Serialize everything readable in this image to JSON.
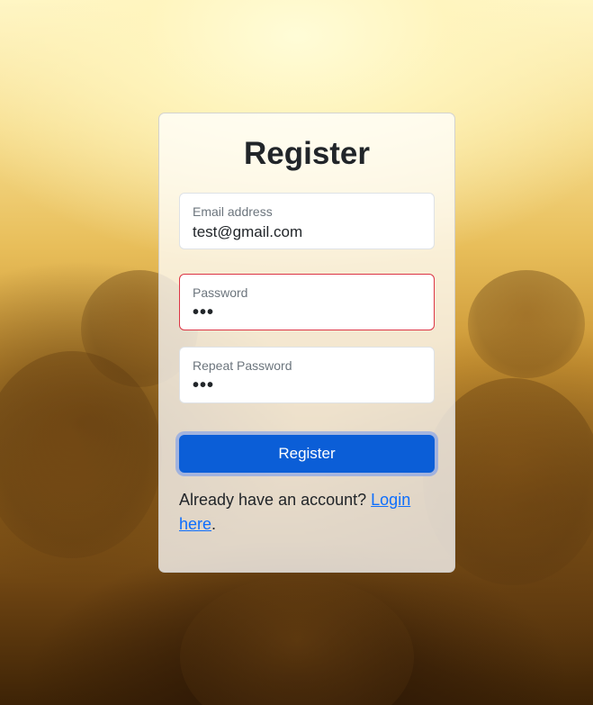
{
  "form": {
    "title": "Register",
    "email": {
      "label": "Email address",
      "value": "test@gmail.com"
    },
    "password": {
      "label": "Password",
      "value": "•••",
      "state": "invalid"
    },
    "repeat_password": {
      "label": "Repeat Password",
      "value": "•••"
    },
    "submit_label": "Register",
    "footer": {
      "prefix": "Already have an account? ",
      "link_text": "Login here",
      "suffix": "."
    }
  },
  "colors": {
    "primary": "#0b5ed7",
    "link": "#0d6efd",
    "invalid_border": "#dc3545",
    "background_top": "#fff6c8",
    "background_bottom": "#3d2306"
  }
}
